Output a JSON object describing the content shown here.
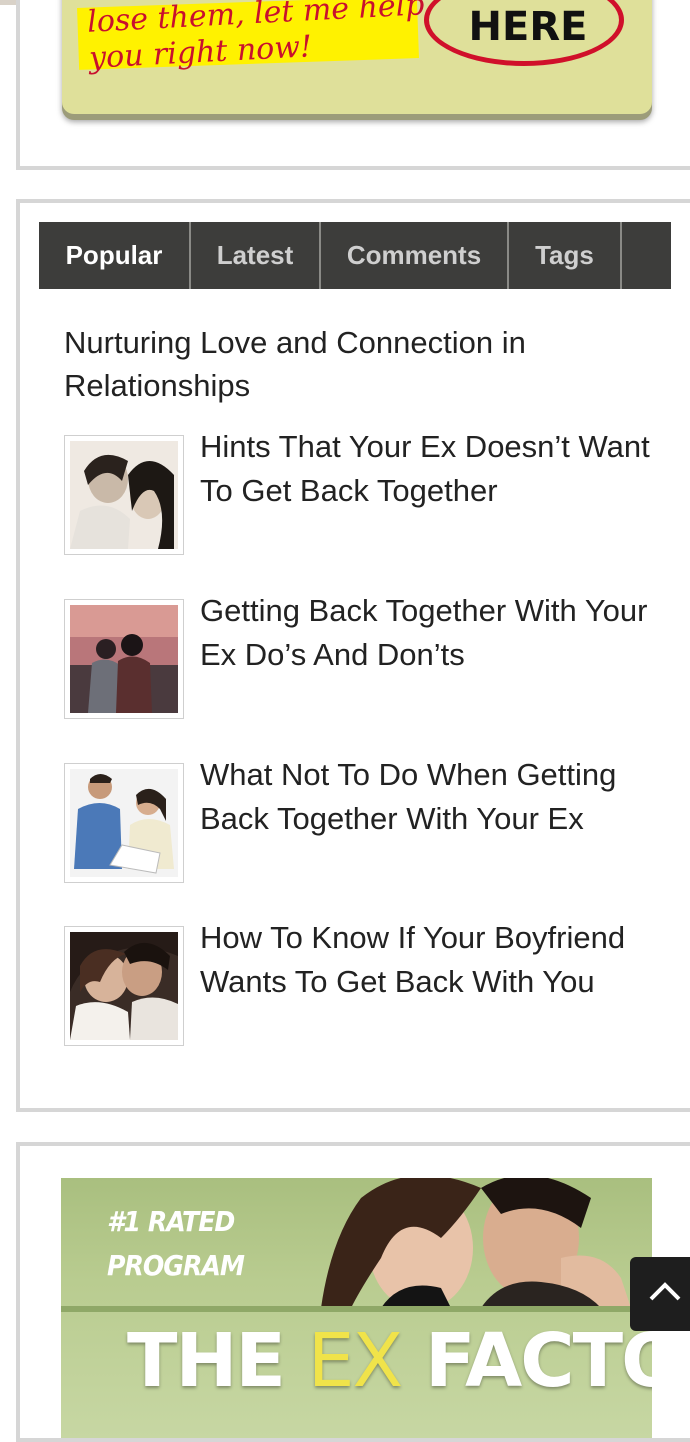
{
  "top_banner": {
    "script_text": "lose them, let me help you right now!",
    "cta": "CLICK HERE"
  },
  "tabs": [
    {
      "label": "Popular",
      "active": true
    },
    {
      "label": "Latest",
      "active": false
    },
    {
      "label": "Comments",
      "active": false
    },
    {
      "label": "Tags",
      "active": false
    }
  ],
  "popular": {
    "top_link": "Nurturing Love and Connection in Relationships",
    "posts": [
      {
        "title": "Hints That Your Ex Doesn’t Want To Get Back Together",
        "thumb_icon": "couple-photo-icon"
      },
      {
        "title": "Getting Back Together With Your Ex Do’s And Don’ts",
        "thumb_icon": "couple-sunset-photo-icon"
      },
      {
        "title": "What Not To Do When Getting Back Together With Your Ex",
        "thumb_icon": "couple-argument-photo-icon"
      },
      {
        "title": "How To Know If Your Boyfriend Wants To Get Back With You",
        "thumb_icon": "couple-embrace-photo-icon"
      }
    ]
  },
  "bottom_ad": {
    "rated_line1": "#1 RATED",
    "rated_line2": "PROGRAM",
    "title_pre": "THE ",
    "title_ex": "EX",
    "title_post": " FACTOR"
  },
  "colors": {
    "tab_bar": "#3d3d3b",
    "widget_border": "#d6d6d6",
    "banner_bg": "#dfe09a",
    "banner_highlight": "#fff200",
    "banner_red": "#c8102e",
    "ad_green": "#a9bf7f"
  },
  "scroll_top_icon": "chevron-up-icon"
}
